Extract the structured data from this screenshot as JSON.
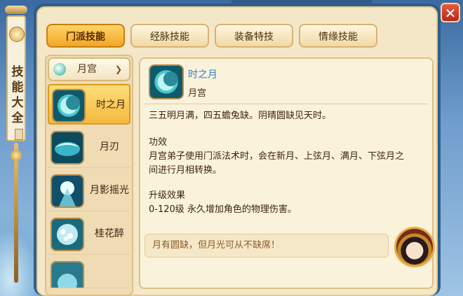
{
  "window": {
    "title": "技能大全",
    "close_glyph": "✕"
  },
  "tabs": [
    {
      "label": "门派技能",
      "active": true
    },
    {
      "label": "经脉技能",
      "active": false
    },
    {
      "label": "装备特技",
      "active": false
    },
    {
      "label": "情缘技能",
      "active": false
    }
  ],
  "dropdown": {
    "selected": "月宫",
    "icon": "moon-palace-icon"
  },
  "skills": [
    {
      "name": "时之月",
      "selected": true,
      "icon": "crescent-moon-icon"
    },
    {
      "name": "月刃",
      "selected": false,
      "icon": "moon-blade-icon"
    },
    {
      "name": "月影摇光",
      "selected": false,
      "icon": "moon-shadow-icon"
    },
    {
      "name": "桂花醉",
      "selected": false,
      "icon": "osmanthus-icon"
    }
  ],
  "detail": {
    "name": "时之月",
    "sect": "月宫",
    "icon": "crescent-moon-icon",
    "description": "三五明月满，四五蟾兔缺。阴晴圆缺见天时。",
    "effect_title": "功效",
    "effect_line1": "月宫弟子使用门派法术时，会在新月、上弦月、满月、下弦月之",
    "effect_line2": "间进行月相转换。",
    "upgrade_title": "升级效果",
    "upgrade_text": "0-120级 永久增加角色的物理伤害。"
  },
  "quote": "月有圆缺，但月光可从不缺席！",
  "colors": {
    "accent": "#f2a626",
    "panel_bg": "#f4e7c8",
    "frame": "#2e5d8c",
    "skill_name": "#2f7fcf"
  }
}
